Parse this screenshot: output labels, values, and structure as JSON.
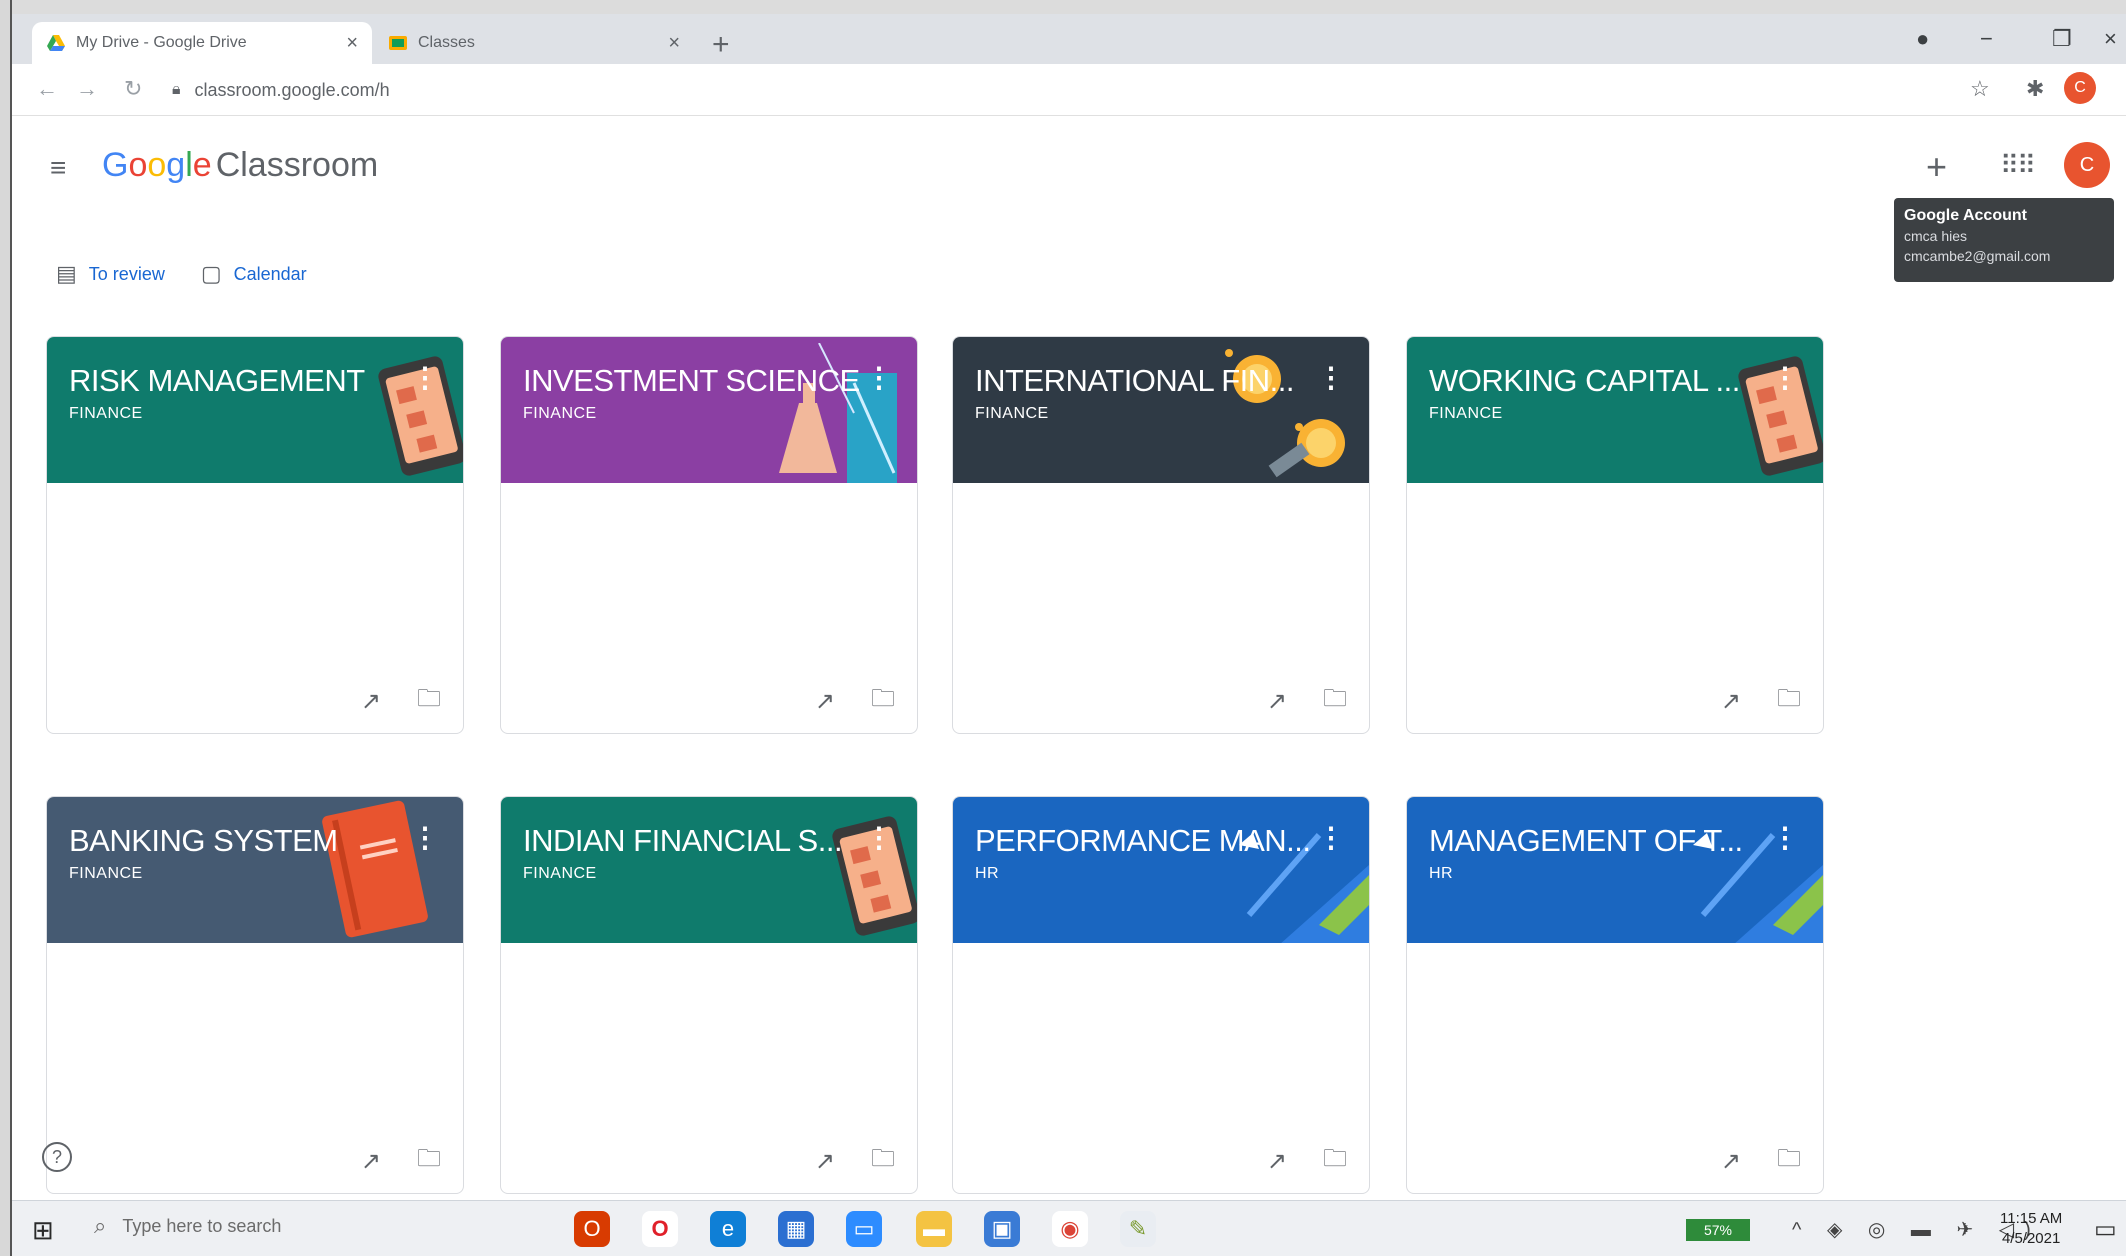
{
  "browser": {
    "tabs": [
      {
        "title": "My Drive - Google Drive",
        "active": true
      },
      {
        "title": "Classes",
        "active": false
      }
    ],
    "url": "classroom.google.com/h",
    "new_tab_icon": "plus-icon"
  },
  "app": {
    "logo_google": [
      "G",
      "o",
      "o",
      "g",
      "l",
      "e"
    ],
    "product_name": "Classroom",
    "header_plus": "+",
    "account_initial": "C"
  },
  "account_tooltip": {
    "title": "Google Account",
    "name": "cmca hies",
    "email": "cmcambe2@gmail.com"
  },
  "subnav": {
    "to_review": "To review",
    "calendar": "Calendar"
  },
  "classes": [
    {
      "title": "RISK MANAGEMENT",
      "section": "FINANCE",
      "color": "#0f7b6c",
      "art": "tablet"
    },
    {
      "title": "INVESTMENT SCIENCE",
      "section": "FINANCE",
      "color": "#8b3fa3",
      "art": "flask"
    },
    {
      "title": "INTERNATIONAL FIN...",
      "section": "FINANCE",
      "color": "#2f3a45",
      "art": "coins"
    },
    {
      "title": "WORKING CAPITAL ...",
      "section": "FINANCE",
      "color": "#0f7b6c",
      "art": "tablet"
    },
    {
      "title": "BANKING SYSTEM",
      "section": "FINANCE",
      "color": "#455a72",
      "art": "book"
    },
    {
      "title": "INDIAN FINANCIAL S...",
      "section": "FINANCE",
      "color": "#0f7b6c",
      "art": "tablet"
    },
    {
      "title": "PERFORMANCE MAN...",
      "section": "HR",
      "color": "#1a66c0",
      "art": "pen"
    },
    {
      "title": "MANAGEMENT OF T...",
      "section": "HR",
      "color": "#1a66c0",
      "art": "pen"
    }
  ],
  "taskbar": {
    "search_placeholder": "Type here to search",
    "battery": "57%",
    "time": "11:15 AM",
    "date": "4/5/2021"
  },
  "help": "?"
}
